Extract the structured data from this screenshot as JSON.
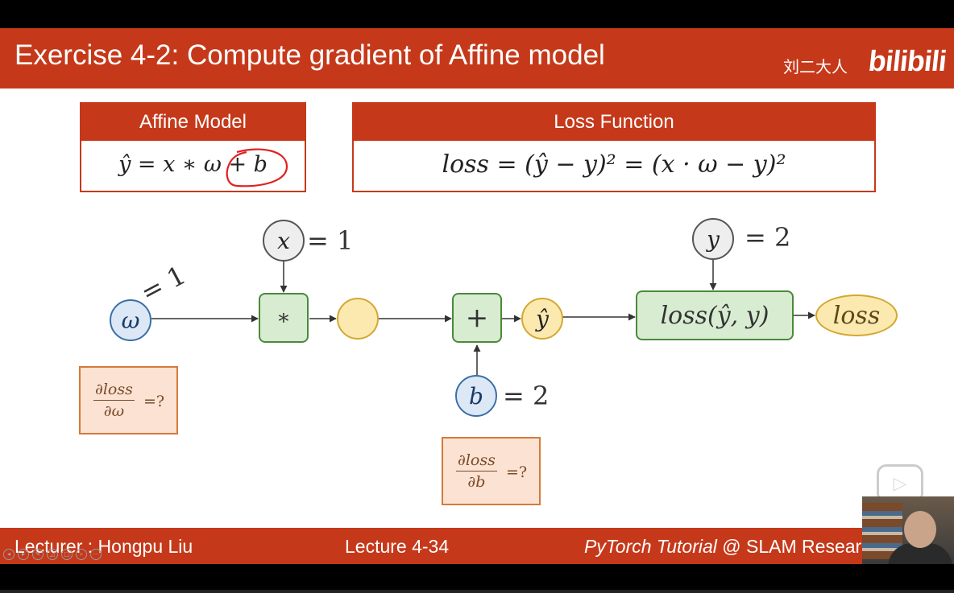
{
  "slide": {
    "title": "Exercise 4-2: Compute gradient of Affine model",
    "watermark_text": "刘二大人",
    "watermark_logo": "bilibili"
  },
  "affine_box": {
    "header": "Affine Model",
    "formula": "ŷ = x ∗ ω + b"
  },
  "loss_box": {
    "header": "Loss Function",
    "formula": "loss = (ŷ − y)² = (x · ω − y)²"
  },
  "graph": {
    "omega_node": "ω",
    "omega_value": "= 1",
    "x_node": "x",
    "x_value": "= 1",
    "mul_op": "∗",
    "add_op": "+",
    "yhat_node": "ŷ",
    "b_node": "b",
    "b_value": "= 2",
    "y_node": "y",
    "y_value": "= 2",
    "loss_op": "loss(ŷ, y)",
    "loss_node": "loss"
  },
  "questions": {
    "dw": {
      "numerator": "∂loss",
      "denominator": "∂ω",
      "suffix": "=?"
    },
    "db": {
      "numerator": "∂loss",
      "denominator": "∂b",
      "suffix": "=?"
    }
  },
  "footer": {
    "lecturer": "Lecturer : Hongpu Liu",
    "lecture": "Lecture 4-34",
    "course_italic": "PyTorch Tutorial",
    "course_rest": " @ SLAM Resear"
  },
  "colors": {
    "accent": "#c5391a",
    "op_fill": "#d8ecd2",
    "input_fill": "#dce8f5",
    "value_fill": "#fbe9b0",
    "question_fill": "#fbe2d2"
  }
}
